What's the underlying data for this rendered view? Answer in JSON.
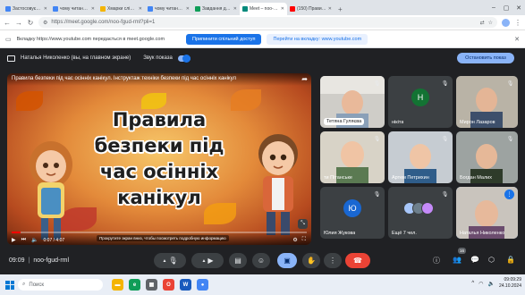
{
  "browser": {
    "tabs": [
      {
        "title": "Застосовуємо та визначаємо",
        "color": "#4285f4",
        "active": false
      },
      {
        "title": "чому читання книг про",
        "color": "#4285f4",
        "active": false
      },
      {
        "title": "Хмарки слів \"Книга у",
        "color": "#f4b400",
        "active": false
      },
      {
        "title": "чому читання книг про",
        "color": "#4285f4",
        "active": false
      },
      {
        "title": "Завдання для курсу \"3",
        "color": "#0f9d58",
        "active": false
      },
      {
        "title": "Meet – noo-fgud-rml",
        "color": "#00897b",
        "active": true
      },
      {
        "title": "(150) Правила безпеки",
        "color": "#ff0000",
        "active": false
      }
    ],
    "url": "https://meet.google.com/noo-fgud-rml?pli=1",
    "translate_label": "Перевести в Google Chrome?",
    "icons": [
      "minimize-icon",
      "maximize-icon",
      "close-icon"
    ]
  },
  "sharebar": {
    "message": "Вкладку https://www.youtube.com передається в meet.google.com",
    "stop_share": "Припинити спільний доступ",
    "switch_tab": "Перейти на вкладку: www.youtube.com"
  },
  "meet": {
    "presenter": "Наталья Николенко (вы, на главном экране)",
    "sound_label": "Звук показа",
    "stop_show": "Остановить показ",
    "video": {
      "title": "Правила безпеки під час осінніх канікул. Інструктаж техніки безпеки під час осінніх канікул",
      "slide_lines": [
        "Правила",
        "безпеки під",
        "час осінніх",
        "канікул"
      ],
      "time": "0:07 / 4:07",
      "progress": 0.03,
      "tip": "Прокрутите экран вниз, чтобы посмотреть подробную информацию"
    },
    "participants": [
      {
        "name": "Тетяна Гуляєва",
        "label_style": "pill"
      },
      {
        "name": "нікіта",
        "initial": "Н",
        "avatar_color": "#137333"
      },
      {
        "name": "Мирон Лазаров"
      },
      {
        "name": "ти Пітанське"
      },
      {
        "name": "Артем Петрихин"
      },
      {
        "name": "Богдан Малих"
      },
      {
        "name": "Юлия Жукова",
        "initial": "Ю",
        "avatar_color": "#1967d2"
      },
      {
        "name": "Ещё 7 чел."
      },
      {
        "name": "Наталья Николенко"
      }
    ],
    "meeting_time": "09:09",
    "meeting_code": "noo-fgud-rml",
    "participant_count": "16",
    "controls": [
      "mic-icon",
      "camera-icon",
      "captions-icon",
      "emoji-icon",
      "present-icon",
      "hand-icon",
      "more-icon",
      "leave-call-icon"
    ],
    "right_controls": [
      "info-icon",
      "people-icon",
      "chat-icon",
      "activities-icon",
      "lock-icon"
    ]
  },
  "taskbar": {
    "search_placeholder": "Поиск",
    "apps": [
      {
        "name": "folder-app",
        "color": "#f4b400",
        "glyph": "▬"
      },
      {
        "name": "edge-app",
        "color": "#0f9d58",
        "glyph": "e"
      },
      {
        "name": "store-app",
        "color": "#5f6368",
        "glyph": "▦"
      },
      {
        "name": "opera-app",
        "color": "#ea4335",
        "glyph": "O"
      },
      {
        "name": "word-app",
        "color": "#185abd",
        "glyph": "W"
      },
      {
        "name": "chrome-app",
        "color": "#4285f4",
        "glyph": "●"
      }
    ],
    "time": "09:09:29",
    "date": "24.10.2024"
  },
  "colors": {
    "accent": "#8ab4f8",
    "leave": "#ea4335",
    "meet_bg": "#202124"
  }
}
